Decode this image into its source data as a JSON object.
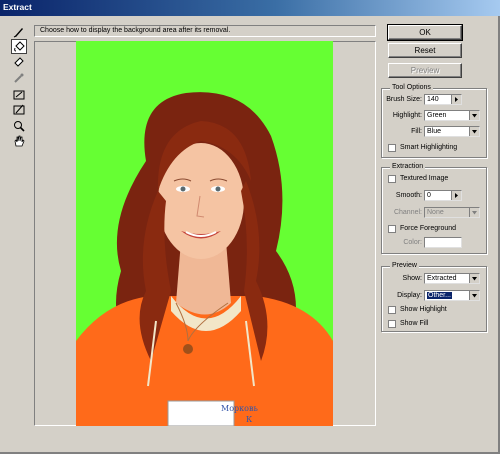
{
  "window": {
    "title": "Extract"
  },
  "hint": "Choose how to display the background area after its removal.",
  "buttons": {
    "ok": "OK",
    "reset": "Reset",
    "preview": "Preview"
  },
  "tool_options": {
    "legend": "Tool Options",
    "brush_size_label": "Brush Size:",
    "brush_size": "140",
    "highlight_label": "Highlight:",
    "highlight": "Green",
    "fill_label": "Fill:",
    "fill": "Blue",
    "smart_highlighting": "Smart Highlighting"
  },
  "extraction": {
    "legend": "Extraction",
    "textured_image": "Textured Image",
    "smooth_label": "Smooth:",
    "smooth": "0",
    "channel_label": "Channel:",
    "channel": "None",
    "force_foreground": "Force Foreground",
    "color_label": "Color:"
  },
  "preview": {
    "legend": "Preview",
    "show_label": "Show:",
    "show": "Extracted",
    "display_label": "Display:",
    "display": "Other...",
    "show_highlight": "Show Highlight",
    "show_fill": "Show Fill"
  },
  "photo": {
    "badge_line1": "Морковь",
    "badge_line2": "К"
  },
  "colors": {
    "background": "#66ff33",
    "shirt": "#ff6a1a",
    "hair": "#8a2a10"
  }
}
